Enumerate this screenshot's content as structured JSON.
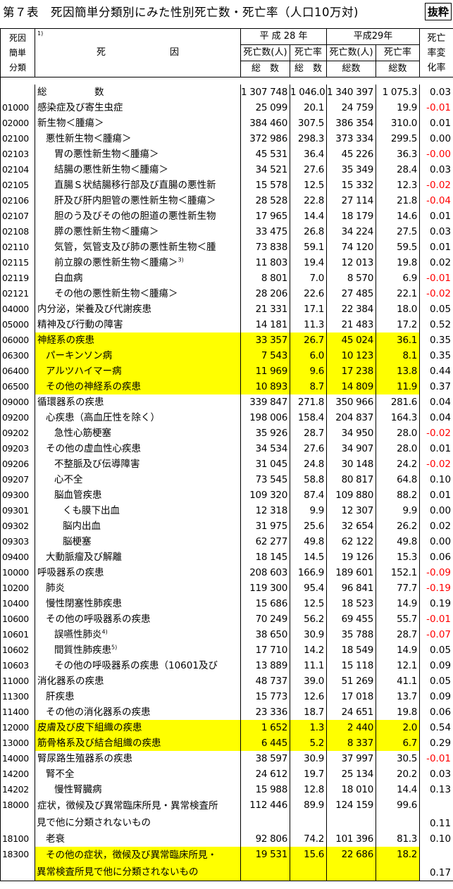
{
  "title": "第７表　死因簡単分類別にみた性別死亡数・死亡率（人口10万対)",
  "badge": "抜粋",
  "header": {
    "code_lines": [
      "死因",
      "簡単",
      "分類"
    ],
    "cause_note": "1)",
    "cause_label": "死　　　　　　　因",
    "year1": "平 成 28 年",
    "year2": "平成29年",
    "deaths_label": "死亡数(人)",
    "rate_label": "死亡率",
    "total_label1": "総　数",
    "total_label2": "総　数",
    "total_label3": "総数",
    "total_label4": "総数",
    "change_lines": [
      "死亡",
      "率変",
      "化率"
    ]
  },
  "rows": [
    {
      "code": "",
      "name": "総　　　　　数",
      "d28": "1 307 748",
      "r28": "1 046.0",
      "d29": "1 340 397",
      "r29": "1 075.3",
      "chg": "0.03"
    },
    {
      "code": "01000",
      "name": "感染症及び寄生虫症",
      "d28": "25 099",
      "r28": "20.1",
      "d29": "24 759",
      "r29": "19.9",
      "chg": "-0.01"
    },
    {
      "code": "02000",
      "name": "新生物＜腫瘍＞",
      "d28": "384 460",
      "r28": "307.5",
      "d29": "386 354",
      "r29": "310.0",
      "chg": "0.01"
    },
    {
      "code": "02100",
      "name": "悪性新生物＜腫瘍＞",
      "d28": "372 986",
      "r28": "298.3",
      "d29": "373 334",
      "r29": "299.5",
      "chg": "0.00"
    },
    {
      "code": "02103",
      "name": "胃の悪性新生物＜腫瘍＞",
      "d28": "45 531",
      "r28": "36.4",
      "d29": "45 226",
      "r29": "36.3",
      "chg": "-0.00"
    },
    {
      "code": "02104",
      "name": "結腸の悪性新生物＜腫瘍＞",
      "d28": "34 521",
      "r28": "27.6",
      "d29": "35 349",
      "r29": "28.4",
      "chg": "0.03"
    },
    {
      "code": "02105",
      "name": "直腸Ｓ状結腸移行部及び直腸の悪性新",
      "d28": "15 578",
      "r28": "12.5",
      "d29": "15 332",
      "r29": "12.3",
      "chg": "-0.02"
    },
    {
      "code": "02106",
      "name": "肝及び肝内胆管の悪性新生物＜腫瘍＞",
      "d28": "28 528",
      "r28": "22.8",
      "d29": "27 114",
      "r29": "21.8",
      "chg": "-0.04"
    },
    {
      "code": "02107",
      "name": "胆のう及びその他の胆道の悪性新生物",
      "d28": "17 965",
      "r28": "14.4",
      "d29": "18 179",
      "r29": "14.6",
      "chg": "0.01"
    },
    {
      "code": "02108",
      "name": "膵の悪性新生物＜腫瘍＞",
      "d28": "33 475",
      "r28": "26.8",
      "d29": "34 224",
      "r29": "27.5",
      "chg": "0.03"
    },
    {
      "code": "02110",
      "name": "気管，気管支及び肺の悪性新生物＜腫",
      "d28": "73 838",
      "r28": "59.1",
      "d29": "74 120",
      "r29": "59.5",
      "chg": "0.01"
    },
    {
      "code": "02115",
      "name": "前立腺の悪性新生物＜腫瘍＞",
      "sup": "3)",
      "d28": "11 803",
      "r28": "19.4",
      "d29": "12 013",
      "r29": "19.8",
      "chg": "0.02"
    },
    {
      "code": "02119",
      "name": "白血病",
      "d28": "8 801",
      "r28": "7.0",
      "d29": "8 570",
      "r29": "6.9",
      "chg": "-0.01"
    },
    {
      "code": "02121",
      "name": "その他の悪性新生物＜腫瘍＞",
      "d28": "28 206",
      "r28": "22.6",
      "d29": "27 485",
      "r29": "22.1",
      "chg": "-0.02"
    },
    {
      "code": "04000",
      "name": "内分泌，栄養及び代謝疾患",
      "d28": "21 331",
      "r28": "17.1",
      "d29": "22 384",
      "r29": "18.0",
      "chg": "0.05"
    },
    {
      "code": "05000",
      "name": "精神及び行動の障害",
      "d28": "14 181",
      "r28": "11.3",
      "d29": "21 483",
      "r29": "17.2",
      "chg": "0.52"
    },
    {
      "code": "06000",
      "name": "神経系の疾患",
      "d28": "33 357",
      "r28": "26.7",
      "d29": "45 024",
      "r29": "36.1",
      "chg": "0.35"
    },
    {
      "code": "06300",
      "name": "パーキンソン病",
      "d28": "7 543",
      "r28": "6.0",
      "d29": "10 123",
      "r29": "8.1",
      "chg": "0.35"
    },
    {
      "code": "06400",
      "name": "アルツハイマー病",
      "d28": "11 969",
      "r28": "9.6",
      "d29": "17 238",
      "r29": "13.8",
      "chg": "0.44"
    },
    {
      "code": "06500",
      "name": "その他の神経系の疾患",
      "d28": "10 893",
      "r28": "8.7",
      "d29": "14 809",
      "r29": "11.9",
      "chg": "0.37"
    },
    {
      "code": "09000",
      "name": "循環器系の疾患",
      "d28": "339 847",
      "r28": "271.8",
      "d29": "350 966",
      "r29": "281.6",
      "chg": "0.04"
    },
    {
      "code": "09200",
      "name": "心疾患（高血圧性を除く）",
      "d28": "198 006",
      "r28": "158.4",
      "d29": "204 837",
      "r29": "164.3",
      "chg": "0.04"
    },
    {
      "code": "09202",
      "name": "急性心筋梗塞",
      "d28": "35 926",
      "r28": "28.7",
      "d29": "34 950",
      "r29": "28.0",
      "chg": "-0.02"
    },
    {
      "code": "09203",
      "name": "その他の虚血性心疾患",
      "d28": "34 534",
      "r28": "27.6",
      "d29": "34 907",
      "r29": "28.0",
      "chg": "0.01"
    },
    {
      "code": "09206",
      "name": "不整脈及び伝導障害",
      "d28": "31 045",
      "r28": "24.8",
      "d29": "30 148",
      "r29": "24.2",
      "chg": "-0.02"
    },
    {
      "code": "09207",
      "name": "心不全",
      "d28": "73 545",
      "r28": "58.8",
      "d29": "80 817",
      "r29": "64.8",
      "chg": "0.10"
    },
    {
      "code": "09300",
      "name": "脳血管疾患",
      "d28": "109 320",
      "r28": "87.4",
      "d29": "109 880",
      "r29": "88.2",
      "chg": "0.01"
    },
    {
      "code": "09301",
      "name": "くも膜下出血",
      "d28": "12 318",
      "r28": "9.9",
      "d29": "12 307",
      "r29": "9.9",
      "chg": "0.00"
    },
    {
      "code": "09302",
      "name": "脳内出血",
      "d28": "31 975",
      "r28": "25.6",
      "d29": "32 654",
      "r29": "26.2",
      "chg": "0.02"
    },
    {
      "code": "09303",
      "name": "脳梗塞",
      "d28": "62 277",
      "r28": "49.8",
      "d29": "62 122",
      "r29": "49.8",
      "chg": "0.00"
    },
    {
      "code": "09400",
      "name": "大動脈瘤及び解離",
      "d28": "18 145",
      "r28": "14.5",
      "d29": "19 126",
      "r29": "15.3",
      "chg": "0.06"
    },
    {
      "code": "10000",
      "name": "呼吸器系の疾患",
      "d28": "208 603",
      "r28": "166.9",
      "d29": "189 601",
      "r29": "152.1",
      "chg": "-0.09"
    },
    {
      "code": "10200",
      "name": "肺炎",
      "d28": "119 300",
      "r28": "95.4",
      "d29": "96 841",
      "r29": "77.7",
      "chg": "-0.19"
    },
    {
      "code": "10400",
      "name": "慢性閉塞性肺疾患",
      "d28": "15 686",
      "r28": "12.5",
      "d29": "18 523",
      "r29": "14.9",
      "chg": "0.19"
    },
    {
      "code": "10600",
      "name": "その他の呼吸器系の疾患",
      "d28": "70 249",
      "r28": "56.2",
      "d29": "69 455",
      "r29": "55.7",
      "chg": "-0.01"
    },
    {
      "code": "10601",
      "name": "誤嚥性肺炎",
      "sup": "4)",
      "d28": "38 650",
      "r28": "30.9",
      "d29": "35 788",
      "r29": "28.7",
      "chg": "-0.07"
    },
    {
      "code": "10602",
      "name": "間質性肺疾患",
      "sup": "5)",
      "d28": "17 710",
      "r28": "14.2",
      "d29": "18 549",
      "r29": "14.9",
      "chg": "0.05"
    },
    {
      "code": "10603",
      "name": "その他の呼吸器系の疾患（10601及び",
      "d28": "13 889",
      "r28": "11.1",
      "d29": "15 118",
      "r29": "12.1",
      "chg": "0.09"
    },
    {
      "code": "11000",
      "name": "消化器系の疾患",
      "d28": "48 737",
      "r28": "39.0",
      "d29": "51 269",
      "r29": "41.1",
      "chg": "0.05"
    },
    {
      "code": "11300",
      "name": "肝疾患",
      "d28": "15 773",
      "r28": "12.6",
      "d29": "17 018",
      "r29": "13.7",
      "chg": "0.09"
    },
    {
      "code": "11400",
      "name": "その他の消化器系の疾患",
      "d28": "23 336",
      "r28": "18.7",
      "d29": "24 651",
      "r29": "19.8",
      "chg": "0.06"
    },
    {
      "code": "12000",
      "name": "皮膚及び皮下組織の疾患",
      "d28": "1 652",
      "r28": "1.3",
      "d29": "2 440",
      "r29": "2.0",
      "chg": "0.54"
    },
    {
      "code": "13000",
      "name": "筋骨格系及び結合組織の疾患",
      "d28": "6 445",
      "r28": "5.2",
      "d29": "8 337",
      "r29": "6.7",
      "chg": "0.29"
    },
    {
      "code": "14000",
      "name": "腎尿路生殖器系の疾患",
      "d28": "38 597",
      "r28": "30.9",
      "d29": "37 997",
      "r29": "30.5",
      "chg": "-0.01"
    },
    {
      "code": "14200",
      "name": "腎不全",
      "d28": "24 612",
      "r28": "19.7",
      "d29": "25 134",
      "r29": "20.2",
      "chg": "0.03"
    },
    {
      "code": "14202",
      "name": "慢性腎臓病",
      "d28": "15 988",
      "r28": "12.8",
      "d29": "18 010",
      "r29": "14.4",
      "chg": "0.13"
    },
    {
      "code": "18000",
      "name": "症状，徴候及び異常臨床所見・異常検査所",
      "name2": "見で他に分類されないもの",
      "d28": "112 446",
      "r28": "89.9",
      "d29": "124 159",
      "r29": "99.6",
      "chg": "0.11"
    },
    {
      "code": "18100",
      "name": "老衰",
      "d28": "92 806",
      "r28": "74.2",
      "d29": "101 396",
      "r29": "81.3",
      "chg": "0.10"
    },
    {
      "code": "18300",
      "name": "その他の症状，徴候及び異常臨床所見・",
      "name2": "異常検査所見で他に分類されないもの",
      "d28": "19 531",
      "r28": "15.6",
      "d29": "22 686",
      "r29": "18.2",
      "chg": "0.17"
    }
  ]
}
